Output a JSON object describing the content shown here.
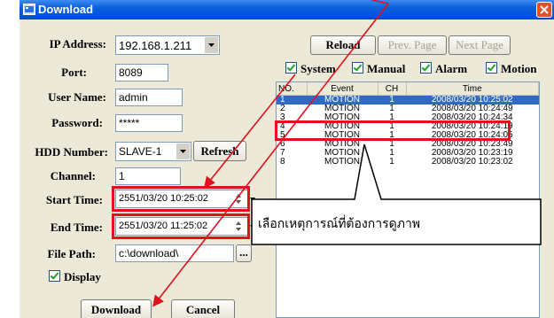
{
  "window": {
    "title": "Download"
  },
  "form": {
    "ip_label": "IP Address:",
    "ip_value": "192.168.1.211",
    "port_label": "Port:",
    "port_value": "8089",
    "user_label": "User Name:",
    "user_value": "admin",
    "password_label": "Password:",
    "password_value": "*****",
    "hdd_label": "HDD Number:",
    "hdd_value": "SLAVE-1",
    "refresh_label": "Refresh",
    "channel_label": "Channel:",
    "channel_value": "1",
    "start_label": "Start Time:",
    "start_value": "2551/03/20 10:25:02",
    "end_label": "End Time:",
    "end_value": "2551/03/20 11:25:02",
    "path_label": "File Path:",
    "path_value": "c:\\download\\",
    "browse_label": "...",
    "display_label": "Display",
    "download_label": "Download",
    "cancel_label": "Cancel"
  },
  "toolbar": {
    "reload_label": "Reload",
    "prev_label": "Prev. Page",
    "next_label": "Next Page"
  },
  "filters": {
    "system": "System",
    "manual": "Manual",
    "alarm": "Alarm",
    "motion": "Motion"
  },
  "list": {
    "headers": [
      "NO.",
      "Event",
      "CH",
      "Time"
    ],
    "rows": [
      {
        "no": "1",
        "event": "MOTION",
        "ch": "1",
        "time": "2008/03/20 10:25:02"
      },
      {
        "no": "2",
        "event": "MOTION",
        "ch": "1",
        "time": "2008/03/20 10:24:49"
      },
      {
        "no": "3",
        "event": "MOTION",
        "ch": "1",
        "time": "2008/03/20 10:24:34"
      },
      {
        "no": "4",
        "event": "MOTION",
        "ch": "1",
        "time": "2008/03/20 10:24:19"
      },
      {
        "no": "5",
        "event": "MOTION",
        "ch": "1",
        "time": "2008/03/20 10:24:05"
      },
      {
        "no": "6",
        "event": "MOTION",
        "ch": "1",
        "time": "2008/03/20 10:23:49"
      },
      {
        "no": "7",
        "event": "MOTION",
        "ch": "1",
        "time": "2008/03/20 10:23:19"
      },
      {
        "no": "8",
        "event": "MOTION",
        "ch": "1",
        "time": "2008/03/20 10:23:02"
      }
    ]
  },
  "annotation": {
    "callout_text": "เลือกเหตุการณ์ที่ต้องการดูภาพ",
    "highlight_color": "#e0101c"
  }
}
